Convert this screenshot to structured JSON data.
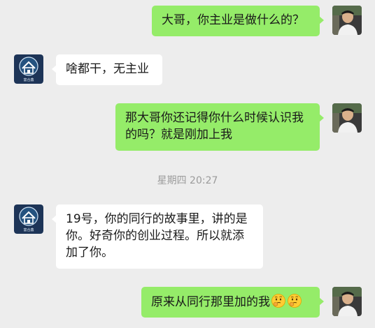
{
  "messages": [
    {
      "sender": "self",
      "text": "大哥，你主业是做什么的？"
    },
    {
      "sender": "other",
      "text": "啥都干，无主业"
    },
    {
      "sender": "self",
      "text": "那大哥你还记得你什么时候认识我的吗？就是刚加上我"
    },
    {
      "sender": "other",
      "text": "19号，你的同行的故事里，讲的是你。好奇你的创业过程。所以就添加了你。"
    },
    {
      "sender": "self",
      "text": "原来从同行那里加的我",
      "emojis": [
        "thinking-face-emoji",
        "thinking-face-emoji"
      ]
    }
  ],
  "timestamp": "星期四 20:27",
  "avatars": {
    "self": {
      "icon": "user-photo-avatar",
      "bg": "#2b2b2b"
    },
    "other": {
      "icon": "house-logo-avatar",
      "bg": "#1d3457",
      "logo_text": "富合鑫"
    }
  },
  "colors": {
    "background": "#ededed",
    "self_bubble": "#95ec69",
    "other_bubble": "#ffffff",
    "timestamp": "#9b9b9b"
  }
}
